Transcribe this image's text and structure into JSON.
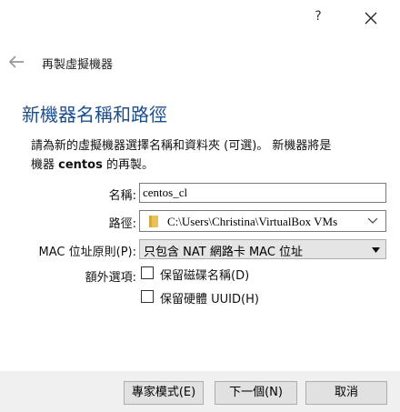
{
  "titlebar": {
    "help_glyph": "?",
    "close_icon": "close-icon"
  },
  "header": {
    "back_icon": "back-arrow-icon",
    "title": "再製虛擬機器"
  },
  "page": {
    "heading": "新機器名稱和路徑",
    "description_line1": "請為新的虛擬機器選擇名稱和資料夾 (可選)。 新機器將是",
    "description_line2_prefix": "機器 ",
    "description_machine": "centos",
    "description_line2_suffix": " 的再製。"
  },
  "form": {
    "name_label": "名稱:",
    "name_value": "centos_cl",
    "path_label": "路徑:",
    "path_value": "C:\\Users\\Christina\\VirtualBox VMs",
    "path_icon": "folder-icon",
    "mac_label": "MAC 位址原則(P):",
    "mac_value": "只包含 NAT 網路卡 MAC 位址",
    "extra_label": "額外選項:",
    "keep_disk_names_label": "保留磁碟名稱(D)",
    "keep_disk_names_checked": false,
    "keep_hw_uuid_label": "保留硬體 UUID(H)",
    "keep_hw_uuid_checked": false
  },
  "footer": {
    "expert_mode": "專家模式(E)",
    "next": "下一個(N)",
    "cancel": "取消"
  },
  "colors": {
    "heading": "#1b4f8f",
    "footer_bg": "#f0f0f0",
    "button_bg": "#e1e1e1"
  }
}
